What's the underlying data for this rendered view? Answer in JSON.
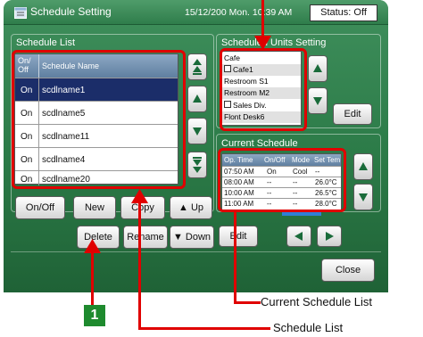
{
  "window": {
    "title": "Schedule Setting",
    "datetime": "15/12/200 Mon. 10:39 AM",
    "status": "Status: Off"
  },
  "schedule_list": {
    "title": "Schedule List",
    "col_onoff": "On/\nOff",
    "col_name": "Schedule Name",
    "rows": [
      {
        "onoff": "On",
        "name": "scdlname1",
        "selected": true
      },
      {
        "onoff": "On",
        "name": "scdlname5",
        "selected": false
      },
      {
        "onoff": "On",
        "name": "scdlname11",
        "selected": false
      },
      {
        "onoff": "On",
        "name": "scdlname4",
        "selected": false
      },
      {
        "onoff": "On",
        "name": "scdlname20",
        "selected": false
      }
    ]
  },
  "scheduled_units": {
    "title": "Scheduled Units Setting",
    "items": [
      "Cafe",
      "Cafe1",
      "Restroom S1",
      "Restroom M2",
      "Sales Div.",
      "Flont Desk6"
    ],
    "edit_label": "Edit"
  },
  "current_schedule": {
    "title": "Current Schedule",
    "headers": [
      "Op. Time",
      "On/Off",
      "Mode",
      "Set Tem"
    ],
    "rows": [
      [
        "07:50 AM",
        "On",
        "Cool",
        "--"
      ],
      [
        "08:00 AM",
        "--",
        "--",
        "26.0°C"
      ],
      [
        "10:00 AM",
        "--",
        "--",
        "26.5°C"
      ],
      [
        "11:00 AM",
        "--",
        "--",
        "28.0°C"
      ]
    ],
    "edit_label": "Edit"
  },
  "buttons": {
    "onoff": "On/Off",
    "new": "New",
    "copy": "Copy",
    "up": "Up",
    "delete": "Delete",
    "rename": "Rename",
    "down": "Down",
    "close": "Close"
  },
  "callouts": {
    "current_schedule_list": "Current Schedule List",
    "schedule_list": "Schedule List",
    "step": "1"
  },
  "colors": {
    "background_green": "#2b7a47",
    "selection": "#1b2d69",
    "highlight_red": "#e00000",
    "callout_green": "#1e8a2e"
  }
}
